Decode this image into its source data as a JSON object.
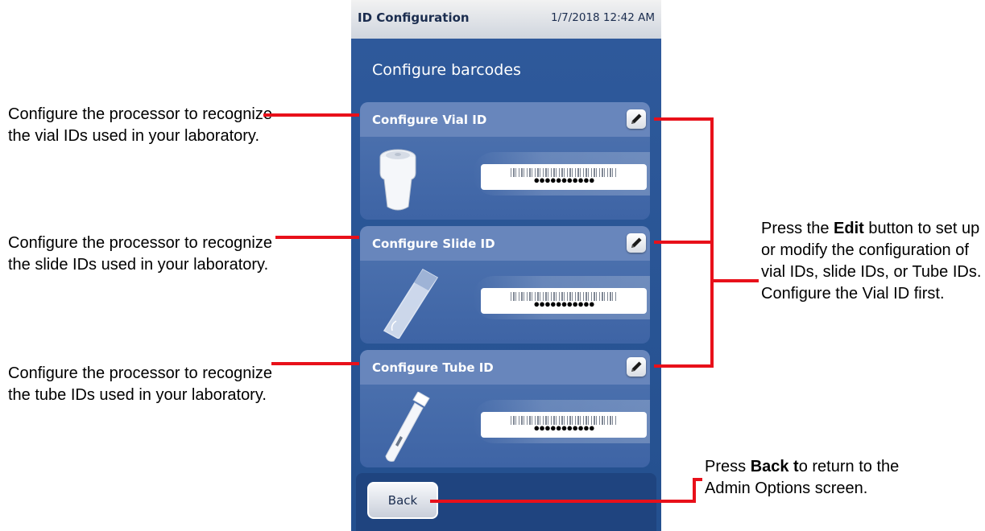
{
  "screen": {
    "title": "ID Configuration",
    "datetime": "1/7/2018 12:42 AM",
    "heading": "Configure barcodes",
    "cards": [
      {
        "title": "Configure Vial ID",
        "barcode_mask": "●●●●●●●●●●●",
        "icon": "vial-icon"
      },
      {
        "title": "Configure Slide ID",
        "barcode_mask": "●●●●●●●●●●●",
        "icon": "slide-icon"
      },
      {
        "title": "Configure Tube ID",
        "barcode_mask": "●●●●●●●●●●●",
        "icon": "tube-icon"
      }
    ],
    "edit_icon": "pencil-icon",
    "back_label": "Back"
  },
  "callouts": {
    "vial": "Configure the processor to recognize the vial IDs used in your laboratory.",
    "slide": "Configure the processor to recognize the slide IDs used in your laboratory.",
    "tube": "Configure the processor to recognize the tube IDs used in your laboratory.",
    "edit_prefix": "Press the ",
    "edit_bold": "Edit",
    "edit_suffix": " button to set up or modify the configuration of vial IDs, slide IDs, or Tube IDs. Configure the Vial ID first.",
    "back_prefix": "Press ",
    "back_bold": "Back t",
    "back_suffix": "o return to the Admin Options screen."
  },
  "colors": {
    "screen_bg": "#2f5a9c",
    "card_bg": "#4f74b0",
    "card_header": "#6886bc",
    "callout_line": "#e8101a"
  }
}
